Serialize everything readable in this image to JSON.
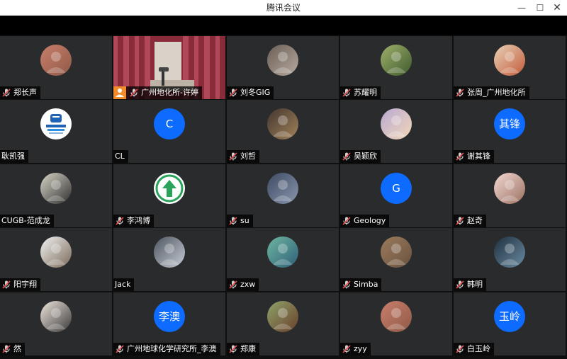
{
  "window": {
    "title": "腾讯会议",
    "controls": {
      "minimize": "—",
      "maximize": "☐",
      "close": "✕"
    }
  },
  "colors": {
    "tile_bg": "#2a2b2d",
    "accent_blue": "#0d6bff",
    "mic_red": "#e34d4d",
    "host_badge": "#f08a2a"
  },
  "participants": [
    {
      "name": "郑长声",
      "avatar": "photo",
      "mic": "muted"
    },
    {
      "name": "广州地化所-许婷",
      "avatar": "video",
      "mic": "muted",
      "host": true
    },
    {
      "name": "刘冬GIG",
      "avatar": "photo",
      "mic": "muted"
    },
    {
      "name": "苏耀明",
      "avatar": "photo",
      "mic": "muted"
    },
    {
      "name": "张周_广州地化所",
      "avatar": "photo",
      "mic": "muted"
    },
    {
      "name": "耿凯强",
      "avatar": "logo",
      "mic": "none"
    },
    {
      "name": "CL",
      "avatar": "initial",
      "initial": "C",
      "mic": "none"
    },
    {
      "name": "刘哲",
      "avatar": "photo",
      "mic": "muted"
    },
    {
      "name": "吴颖欣",
      "avatar": "photo",
      "mic": "muted"
    },
    {
      "name": "谢其锋",
      "avatar": "initial",
      "initial": "其锋",
      "mic": "muted"
    },
    {
      "name": "CUGB-范成龙",
      "avatar": "photo",
      "mic": "none"
    },
    {
      "name": "李鸿博",
      "avatar": "arrow",
      "mic": "muted"
    },
    {
      "name": "su",
      "avatar": "photo",
      "mic": "muted"
    },
    {
      "name": "Geology",
      "avatar": "initial",
      "initial": "G",
      "mic": "muted"
    },
    {
      "name": "赵奇",
      "avatar": "photo",
      "mic": "muted"
    },
    {
      "name": "阳宇翔",
      "avatar": "photo",
      "mic": "muted"
    },
    {
      "name": "Jack",
      "avatar": "photo",
      "mic": "none"
    },
    {
      "name": "zxw",
      "avatar": "photo",
      "mic": "muted"
    },
    {
      "name": "Simba",
      "avatar": "photo",
      "mic": "muted"
    },
    {
      "name": "韩明",
      "avatar": "photo",
      "mic": "muted"
    },
    {
      "name": "然",
      "avatar": "photo",
      "mic": "muted"
    },
    {
      "name": "广州地球化学研究所_李澳",
      "avatar": "initial",
      "initial": "李澳",
      "mic": "muted"
    },
    {
      "name": "郑康",
      "avatar": "photo",
      "mic": "muted"
    },
    {
      "name": "zyy",
      "avatar": "photo",
      "mic": "muted"
    },
    {
      "name": "白玉岭",
      "avatar": "initial",
      "initial": "玉岭",
      "mic": "muted"
    }
  ]
}
